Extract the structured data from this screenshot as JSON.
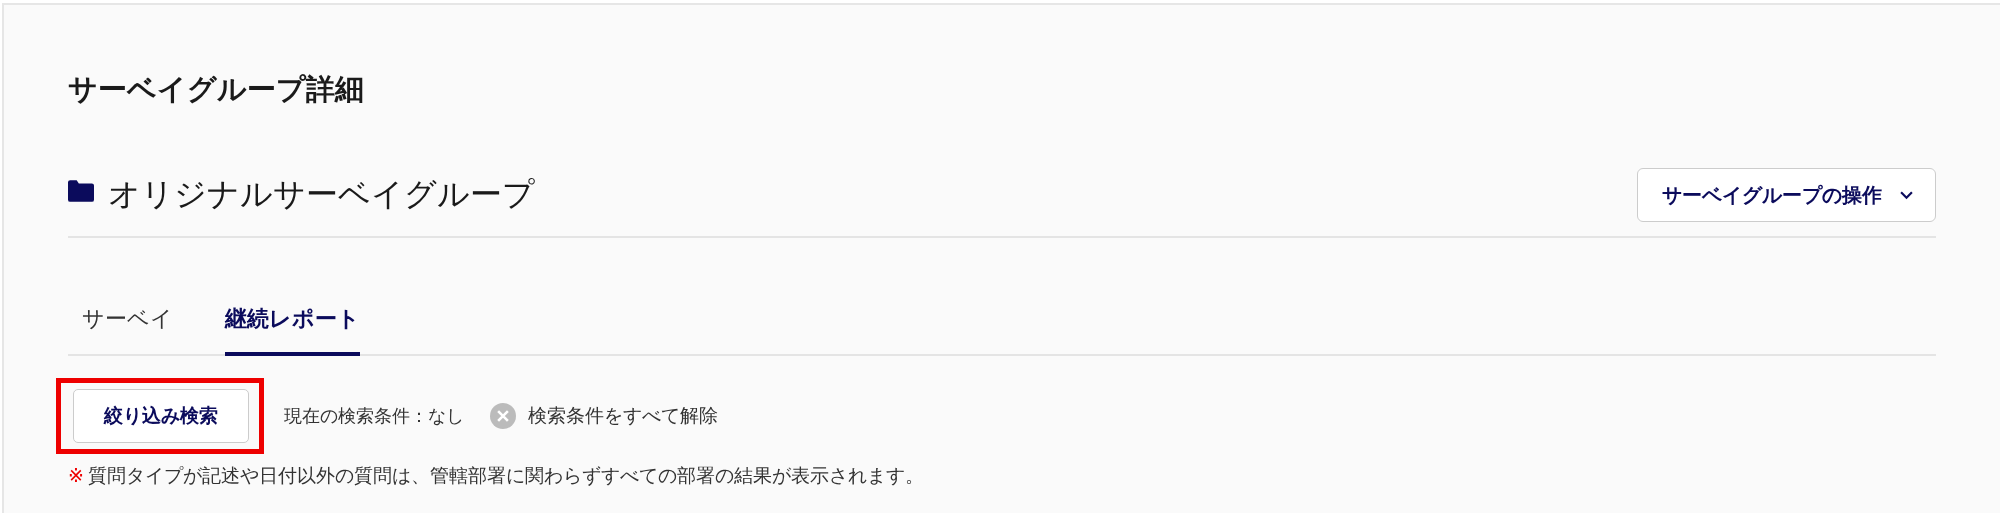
{
  "page_title": "サーベイグループ詳細",
  "group": {
    "name": "オリジナルサーベイグループ",
    "actions_button": "サーベイグループの操作"
  },
  "tabs": [
    {
      "label": "サーベイ",
      "selected": false
    },
    {
      "label": "継続レポート",
      "selected": true
    }
  ],
  "filter": {
    "button": "絞り込み検索",
    "highlighted": true,
    "current_conditions": "現在の検索条件：なし",
    "clear_all": "検索条件をすべて解除"
  },
  "note": {
    "mark": "※",
    "text": "質問タイプが記述や日付以外の質問は、管轄部署に関わらずすべての部署の結果が表示されます。"
  }
}
